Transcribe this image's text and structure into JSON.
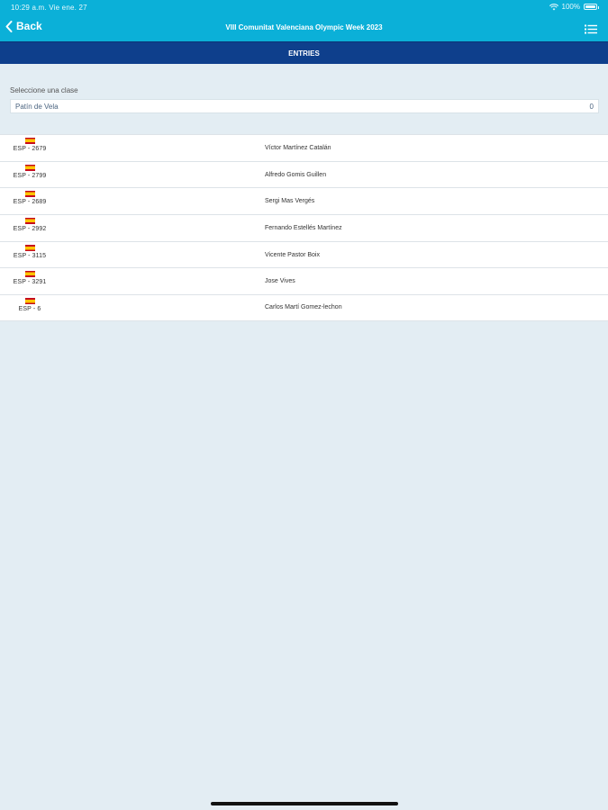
{
  "status": {
    "time": "10:29 a.m.   Vie ene. 27",
    "battery": "100%"
  },
  "nav": {
    "back_label": "Back",
    "title": "VIII Comunitat Valenciana Olympic Week 2023"
  },
  "section": {
    "title": "ENTRIES"
  },
  "class_select": {
    "label": "Seleccione una clase",
    "value": "Patín de Vela",
    "count": "0"
  },
  "entries": [
    {
      "sail": "ESP - 2679",
      "name": "Víctor Martínez Catalán"
    },
    {
      "sail": "ESP - 2799",
      "name": "Alfredo Gomis Guillen"
    },
    {
      "sail": "ESP - 2689",
      "name": "Sergi Mas Vergés"
    },
    {
      "sail": "ESP - 2992",
      "name": "Fernando Estellés Martínez"
    },
    {
      "sail": "ESP - 3115",
      "name": "Vicente Pastor Boix"
    },
    {
      "sail": "ESP - 3291",
      "name": "Jose Vives"
    },
    {
      "sail": "ESP - 6",
      "name": "Carlos Martí Gomez-lechon"
    }
  ],
  "colors": {
    "topbar": "#0bb0d8",
    "section_header": "#0e3f8c",
    "background": "#e3edf3"
  },
  "icons": {
    "back": "chevron-left-icon",
    "menu": "list-menu-icon",
    "wifi": "wifi-icon",
    "battery": "battery-icon",
    "flag": "spain-flag-icon"
  }
}
